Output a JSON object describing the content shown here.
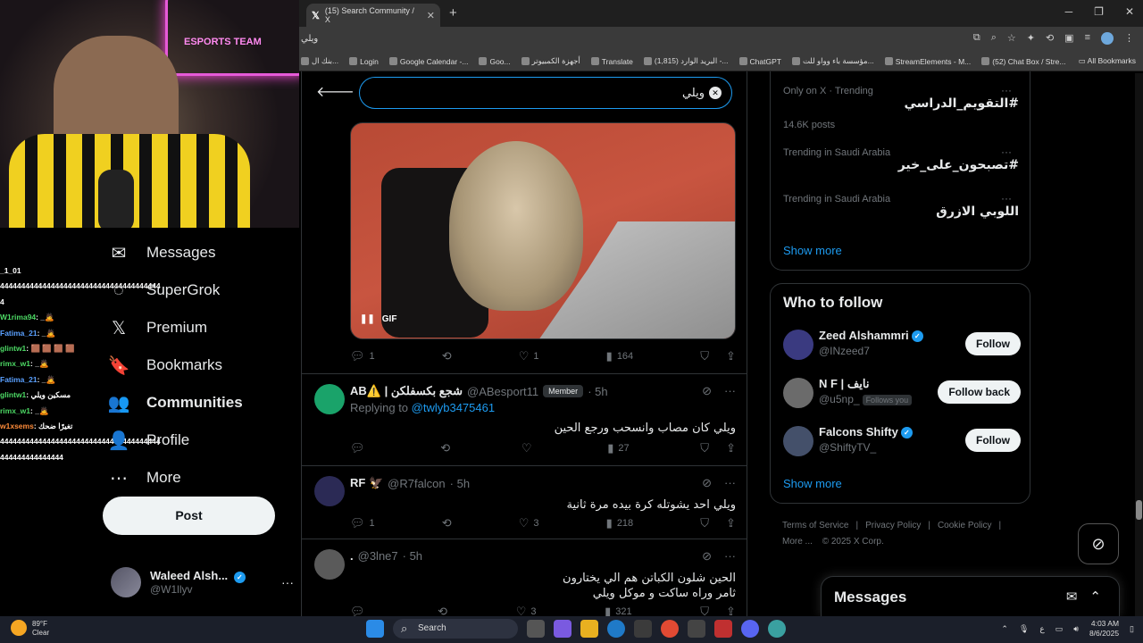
{
  "browser": {
    "tab_title": "(15) Search Community / X",
    "address": "ويلي",
    "bookmarks": [
      "بنك ال...",
      "Login",
      "Google Calendar -...",
      "Goo...",
      "أجهزة الكمبيوتر",
      "Translate",
      "(1,815) البريد الوارد -...",
      "ChatGPT",
      "مؤسسة باء وواو للت...",
      "StreamElements - M...",
      "(52) Chat Box / Stre..."
    ],
    "all_bookmarks": "All Bookmarks"
  },
  "stream": {
    "neon_text": "ESPORTS TEAM",
    "chat": [
      {
        "user": "",
        "msg": "_1_01",
        "color": "#ffffff"
      },
      {
        "user": "",
        "msg": "44444444444444444444444444444444444444",
        "color": "#ffffff"
      },
      {
        "user": "",
        "msg": "4",
        "color": "#ffffff"
      },
      {
        "user": "W1rima94",
        "msg": ": _🙇",
        "color": "#4cd964"
      },
      {
        "user": "Fatima_21",
        "msg": ": _🙇",
        "color": "#5aa0ff"
      },
      {
        "user": "glintw1",
        "msg": ": 🟫 🟫 🟫 🟫",
        "color": "#4cd964"
      },
      {
        "user": "rimx_w1",
        "msg": ": _🙇",
        "color": "#4cd964"
      },
      {
        "user": "Fatima_21",
        "msg": ": _🙇",
        "color": "#5aa0ff"
      },
      {
        "user": "glintw1",
        "msg": ": مسكين ويلي",
        "color": "#4cd964"
      },
      {
        "user": "rimx_w1",
        "msg": ": _🙇",
        "color": "#4cd964"
      },
      {
        "user": "w1xsems",
        "msg": ": تغيرًا ضحك",
        "color": "#ff8c3a"
      },
      {
        "user": "",
        "msg": "44444444444444444444444444444444444444",
        "color": "#ffffff"
      },
      {
        "user": "",
        "msg": "444444444444444",
        "color": "#ffffff"
      }
    ]
  },
  "nav": {
    "items": [
      {
        "label": "Messages",
        "icon": "envelope-icon",
        "glyph": "✉",
        "bold": false
      },
      {
        "label": "SuperGrok",
        "icon": "grok-icon",
        "glyph": "◌",
        "bold": false
      },
      {
        "label": "Premium",
        "icon": "x-premium-icon",
        "glyph": "𝕏",
        "bold": false
      },
      {
        "label": "Bookmarks",
        "icon": "bookmark-icon",
        "glyph": "🔖",
        "bold": false
      },
      {
        "label": "Communities",
        "icon": "communities-icon",
        "glyph": "👥",
        "bold": true
      },
      {
        "label": "Profile",
        "icon": "profile-icon",
        "glyph": "👤",
        "bold": false
      },
      {
        "label": "More",
        "icon": "more-circle-icon",
        "glyph": "⋯",
        "bold": false
      }
    ],
    "post_label": "Post",
    "account_name": "Waleed Alsh...",
    "account_handle": "@W1llyv"
  },
  "search": {
    "query": "ويلي"
  },
  "gif_tweet": {
    "badge": "GIF",
    "replies": "1",
    "likes": "1",
    "views": "164"
  },
  "tweets": [
    {
      "name": "AB⚠️ | شجع بكسفلكن",
      "handle": "@ABesport11",
      "badge": "Member",
      "time": "· 5h",
      "replying_prefix": "Replying to ",
      "replying_to": "@twlyb3475461",
      "text": "ويلي كان مصاب وانسحب ورجع الحين",
      "replies": "",
      "likes": "",
      "views": "27",
      "avatar_color": "#1aa36a"
    },
    {
      "name": "RF 🦅",
      "handle": "@R7falcon",
      "badge": "",
      "time": "· 5h",
      "replying_prefix": "",
      "replying_to": "",
      "text": "ويلي احد يشوتله كرة بيده مرة ثانية",
      "replies": "1",
      "likes": "3",
      "views": "218",
      "avatar_color": "#2b2a55"
    },
    {
      "name": ".",
      "handle": "@3lne7",
      "badge": "",
      "time": "· 5h",
      "replying_prefix": "",
      "replying_to": "",
      "text": "الحين شلون الكباتن هم الي يختارون\nثامر وراه ساكت و موكل ويلي",
      "replies": "",
      "likes": "3",
      "views": "321",
      "avatar_color": "#5a5a5a"
    }
  ],
  "trends": [
    {
      "meta": "Only on X · Trending",
      "name": "#التقويم_الدراسي",
      "posts": "14.6K posts"
    },
    {
      "meta": "Trending in Saudi Arabia",
      "name": "#تصبحون_على_خير",
      "posts": ""
    },
    {
      "meta": "Trending in Saudi Arabia",
      "name": "اللوبي الازرق",
      "posts": ""
    }
  ],
  "show_more": "Show more",
  "who_to_follow": {
    "title": "Who to follow",
    "people": [
      {
        "name": "Zeed Alshammri",
        "handle": "@INzeed7",
        "follows_you": "",
        "button": "Follow",
        "verified": true,
        "avatar_color": "#3a3a80"
      },
      {
        "name": "N F | نايف",
        "handle": "@u5np_",
        "follows_you": "Follows you",
        "button": "Follow back",
        "verified": false,
        "avatar_color": "#6b6b6b"
      },
      {
        "name": "Falcons Shifty",
        "handle": "@ShiftyTV_",
        "follows_you": "",
        "button": "Follow",
        "verified": true,
        "avatar_color": "#44506a"
      }
    ],
    "show_more": "Show more"
  },
  "footer": {
    "links": [
      "Terms of Service",
      "|",
      "Privacy Policy",
      "|",
      "Cookie Policy",
      "|"
    ],
    "more": "More ...",
    "copyright": "© 2025 X Corp."
  },
  "messages_drawer": {
    "title": "Messages"
  },
  "taskbar": {
    "temp": "89°F",
    "condition": "Clear",
    "search_label": "Search",
    "time": "4:03 AM",
    "date": "8/6/2025",
    "lang": "ع"
  },
  "colors": {
    "accent": "#1d9bf0",
    "border": "#2f3336",
    "muted": "#71767b"
  }
}
